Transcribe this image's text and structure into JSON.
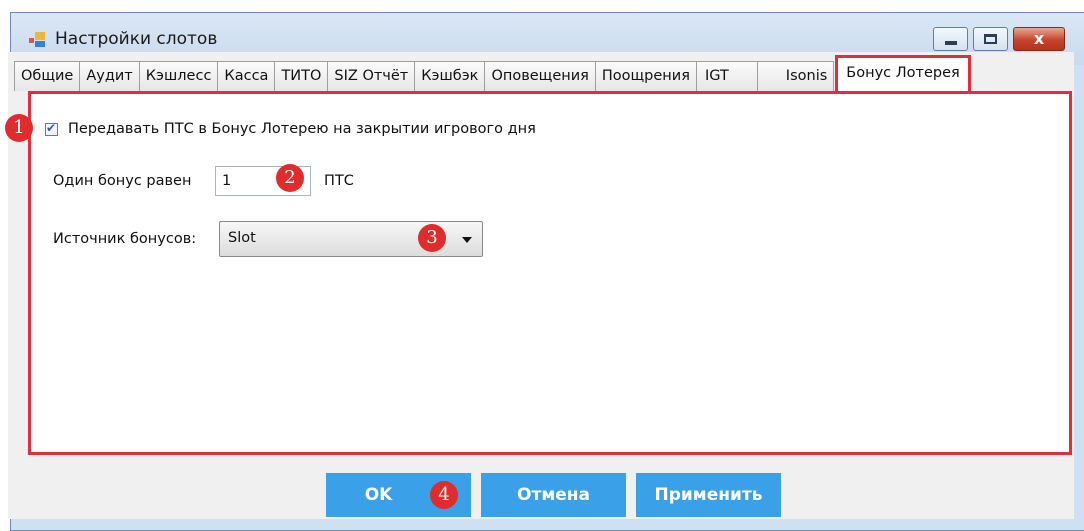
{
  "window": {
    "title": "Настройки слотов",
    "close_glyph": "x",
    "accent_color": "#e02f3c",
    "button_color": "#3aa0e8"
  },
  "tabs": [
    {
      "label": "Общие"
    },
    {
      "label": "Аудит"
    },
    {
      "label": "Кэшлесс"
    },
    {
      "label": "Касса"
    },
    {
      "label": "ТИТО"
    },
    {
      "label": "SIZ Отчёт"
    },
    {
      "label": "Кэшбэк"
    },
    {
      "label": "Оповещения"
    },
    {
      "label": "Поощрения"
    },
    {
      "label": "IGT"
    },
    {
      "label": "Isonis"
    },
    {
      "label": "Бонус Лотерея",
      "selected": true
    }
  ],
  "panel": {
    "transfer_checkbox": {
      "label": "Передавать ПТС в Бонус Лотерею на закрытии игрового дня",
      "checked": true
    },
    "bonus_equals_label": "Один бонус равен",
    "bonus_value": "1",
    "bonus_unit": "ПТС",
    "source_label": "Источник бонусов:",
    "source_value": "Slot"
  },
  "buttons": {
    "ok": "OK",
    "cancel": "Отмена",
    "apply": "Применить"
  },
  "badges": [
    "1",
    "2",
    "3",
    "4"
  ]
}
